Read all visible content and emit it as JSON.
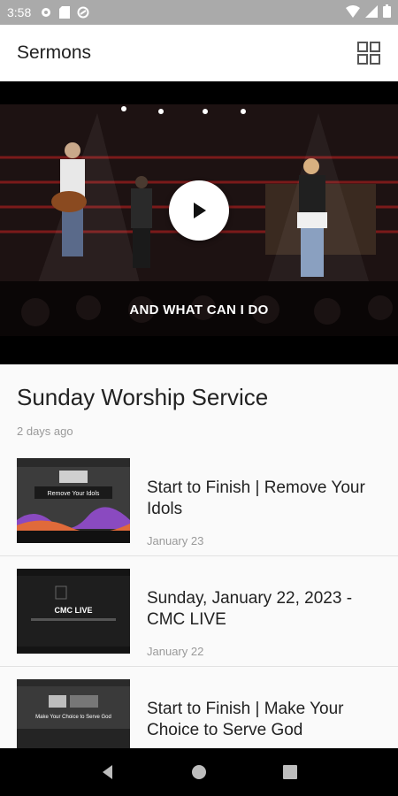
{
  "status_bar": {
    "time": "3:58"
  },
  "app_bar": {
    "title": "Sermons"
  },
  "video": {
    "caption": "AND WHAT CAN I DO"
  },
  "featured": {
    "title": "Sunday Worship Service",
    "date": "2 days ago"
  },
  "items": [
    {
      "title": "Start to Finish | Remove Your Idols",
      "date": "January 23",
      "thumb_text": "Remove Your Idols"
    },
    {
      "title": "Sunday, January 22, 2023 - CMC LIVE",
      "date": "January 22",
      "thumb_text": "CMC LIVE"
    },
    {
      "title": "Start to Finish | Make Your Choice to Serve God",
      "date": "",
      "thumb_text": "Make Your Choice to Serve God"
    }
  ]
}
